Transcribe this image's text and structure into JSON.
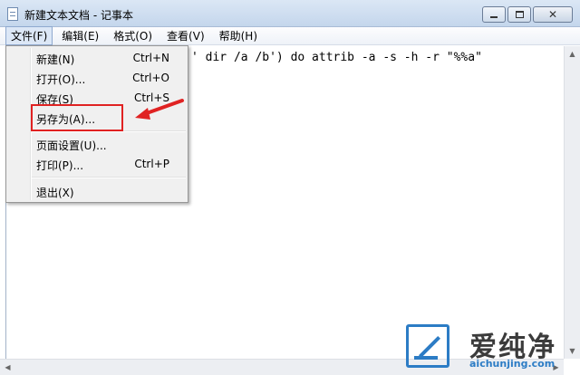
{
  "window": {
    "title": "新建文本文档 - 记事本",
    "icon": "notepad-icon",
    "controls": {
      "minimize_icon": "minimize-icon",
      "maximize_icon": "maximize-icon",
      "close_icon": "close-icon",
      "close_glyph": "✕"
    }
  },
  "menubar": {
    "items": [
      {
        "label": "文件(F)",
        "active": true
      },
      {
        "label": "编辑(E)"
      },
      {
        "label": "格式(O)"
      },
      {
        "label": "查看(V)"
      },
      {
        "label": "帮助(H)"
      }
    ]
  },
  "editor": {
    "visible_text": "' dir /a /b') do attrib -a -s -h -r \"%%a\""
  },
  "file_menu": {
    "items": [
      {
        "label": "新建(N)",
        "shortcut": "Ctrl+N"
      },
      {
        "label": "打开(O)...",
        "shortcut": "Ctrl+O"
      },
      {
        "label": "保存(S)",
        "shortcut": "Ctrl+S"
      },
      {
        "label": "另存为(A)...",
        "shortcut": ""
      },
      {
        "label": "页面设置(U)...",
        "shortcut": ""
      },
      {
        "label": "打印(P)...",
        "shortcut": "Ctrl+P"
      },
      {
        "label": "退出(X)",
        "shortcut": ""
      }
    ]
  },
  "annotation": {
    "highlight_color": "#e02222",
    "highlighted_item": "另存为(A)..."
  },
  "watermark": {
    "title": "爱纯净",
    "url": "aichunjing.com",
    "brand_color": "#2c7cc5"
  },
  "scrollbar_icons": {
    "up": "▲",
    "down": "▼",
    "left": "◀",
    "right": "▶"
  }
}
